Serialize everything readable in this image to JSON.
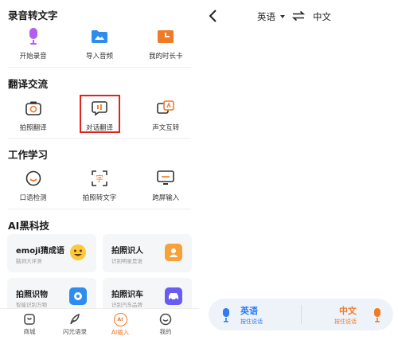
{
  "left": {
    "sections": [
      {
        "title": "录音转文字",
        "items": [
          {
            "label": "开始录音",
            "icon": "microphone-icon"
          },
          {
            "label": "导入音频",
            "icon": "folder-icon"
          },
          {
            "label": "我的时长卡",
            "icon": "clock-card-icon"
          }
        ]
      },
      {
        "title": "翻译交流",
        "items": [
          {
            "label": "拍照翻译",
            "icon": "camera-translate-icon"
          },
          {
            "label": "对话翻译",
            "icon": "dialog-translate-icon"
          },
          {
            "label": "声文互转",
            "icon": "voice-text-icon"
          }
        ]
      },
      {
        "title": "工作学习",
        "items": [
          {
            "label": "口语检测",
            "icon": "speech-check-icon"
          },
          {
            "label": "拍照转文字",
            "icon": "scan-text-icon"
          },
          {
            "label": "跨屏输入",
            "icon": "cross-screen-icon"
          }
        ]
      },
      {
        "title": "AI黑科技",
        "cards": [
          {
            "title": "emoji猜成语",
            "subtitle": "脑洞大评测",
            "icon": "emoji-icon",
            "color": "#fde6a6"
          },
          {
            "title": "拍照识人",
            "subtitle": "识别明星是谁",
            "icon": "person-card-icon",
            "color": "#f7a13a"
          },
          {
            "title": "拍照识物",
            "subtitle": "智能识别万物",
            "icon": "object-scan-icon",
            "color": "#2d8cf0"
          },
          {
            "title": "拍照识车",
            "subtitle": "识别汽车品牌",
            "icon": "car-icon",
            "color": "#6a5cf0"
          }
        ]
      }
    ],
    "tabbar": [
      {
        "label": "商城",
        "icon": "shop-icon",
        "active": false
      },
      {
        "label": "闪光语录",
        "icon": "quill-icon",
        "active": false
      },
      {
        "label": "AI输入",
        "icon": "ai-input-icon",
        "active": true
      },
      {
        "label": "我的",
        "icon": "profile-icon",
        "active": false
      }
    ]
  },
  "right": {
    "source_lang": "英语",
    "target_lang": "中文",
    "speak_left": {
      "title": "英语",
      "subtitle": "按住说话",
      "color": "#2f7cf6"
    },
    "speak_right": {
      "title": "中文",
      "subtitle": "按住说话",
      "color": "#f07a28"
    }
  },
  "colors": {
    "accent_orange": "#f07a28",
    "accent_blue": "#2f7cf6",
    "highlight_red": "#e0241b"
  }
}
